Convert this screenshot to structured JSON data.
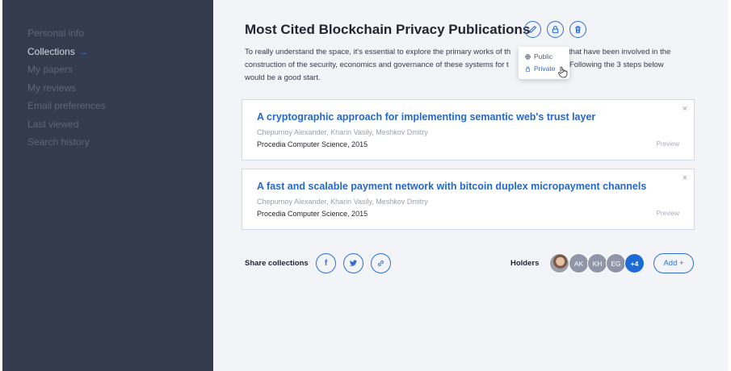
{
  "sidebar": {
    "items": [
      {
        "label": "Personal info"
      },
      {
        "label": "Collections",
        "arrow": "→"
      },
      {
        "label": "My papers"
      },
      {
        "label": "My reviews"
      },
      {
        "label": "Email preferences"
      },
      {
        "label": "Last viewed"
      },
      {
        "label": "Search history"
      }
    ]
  },
  "collection": {
    "title": "Most Cited Blockchain Privacy Publications",
    "actions": {
      "edit_icon": "pencil-icon",
      "lock_icon": "lock-icon",
      "delete_icon": "trash-icon"
    },
    "description_line1": "To really understand the space, it's essential to explore the primary works of th",
    "description_line1b": "ors that have been involved in the",
    "description_line2": "construction of the security, economics and governance of these systems for t",
    "description_line2b": "l years. Following the 3 steps below",
    "description_line3": "would be a good start."
  },
  "visibility_menu": {
    "options": [
      {
        "label": "Public",
        "icon": "globe-icon"
      },
      {
        "label": "Private",
        "icon": "lock-icon",
        "selected": true
      }
    ]
  },
  "papers": [
    {
      "title": "A cryptographic approach for implementing semantic web's trust layer",
      "authors": "Chepurnoy Alexander, Kharin Vasily, Meshkov Dmitry",
      "journal": "Procedia Computer Science, 2015",
      "preview": "Preview",
      "close": "×"
    },
    {
      "title": "A fast and scalable payment network with bitcoin duplex micropayment channels",
      "authors": "Chepurnoy Alexander, Kharin Vasily, Meshkov Dmitry",
      "journal": "Procedia Computer Science, 2015",
      "preview": "Preview",
      "close": "×"
    }
  ],
  "share": {
    "label": "Share collections",
    "facebook": "f",
    "buttons": [
      "facebook-icon",
      "twitter-icon",
      "link-icon"
    ]
  },
  "holders": {
    "label": "Holders",
    "avatars": [
      "AK",
      "KH",
      "EG"
    ],
    "more": "+4",
    "add_label": "Add +"
  },
  "colors": {
    "sidebar_bg": "#343b4c",
    "accent": "#2b6fd3",
    "main_bg": "#f3f4f7"
  }
}
